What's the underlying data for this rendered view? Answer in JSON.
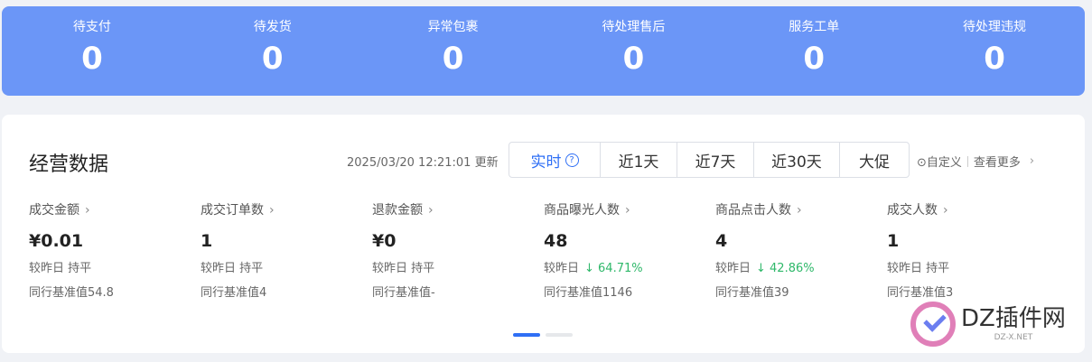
{
  "banner": {
    "stats": [
      {
        "label": "待支付",
        "value": "0"
      },
      {
        "label": "待发货",
        "value": "0"
      },
      {
        "label": "异常包裹",
        "value": "0"
      },
      {
        "label": "待处理售后",
        "value": "0"
      },
      {
        "label": "服务工单",
        "value": "0"
      },
      {
        "label": "待处理违规",
        "value": "0"
      }
    ]
  },
  "card": {
    "title": "经营数据",
    "update_text": "2025/03/20 12:21:01 更新",
    "tabs": {
      "realtime": "实时",
      "d1": "近1天",
      "d7": "近7天",
      "d30": "近30天",
      "promo": "大促"
    },
    "customize": "⊙自定义",
    "view_more": "查看更多",
    "metrics": [
      {
        "label": "成交金额",
        "value": "¥0.01",
        "compare": "较昨日 持平",
        "bench": "同行基准值54.8"
      },
      {
        "label": "成交订单数",
        "value": "1",
        "compare": "较昨日 持平",
        "bench": "同行基准值4"
      },
      {
        "label": "退款金额",
        "value": "¥0",
        "compare": "较昨日 持平",
        "bench": "同行基准值-"
      },
      {
        "label": "商品曝光人数",
        "value": "48",
        "compare": "较昨日",
        "delta": "↓ 64.71%",
        "bench": "同行基准值1146"
      },
      {
        "label": "商品点击人数",
        "value": "4",
        "compare": "较昨日",
        "delta": "↓ 42.86%",
        "bench": "同行基准值39"
      },
      {
        "label": "成交人数",
        "value": "1",
        "compare": "较昨日 持平",
        "bench": "同行基准值3"
      }
    ]
  },
  "watermark": {
    "title": "DZ插件网",
    "sub": "DZ-X.NET"
  },
  "colors": {
    "banner": "#6b96f7",
    "accent": "#2f6ff5",
    "down": "#2fb86a"
  }
}
